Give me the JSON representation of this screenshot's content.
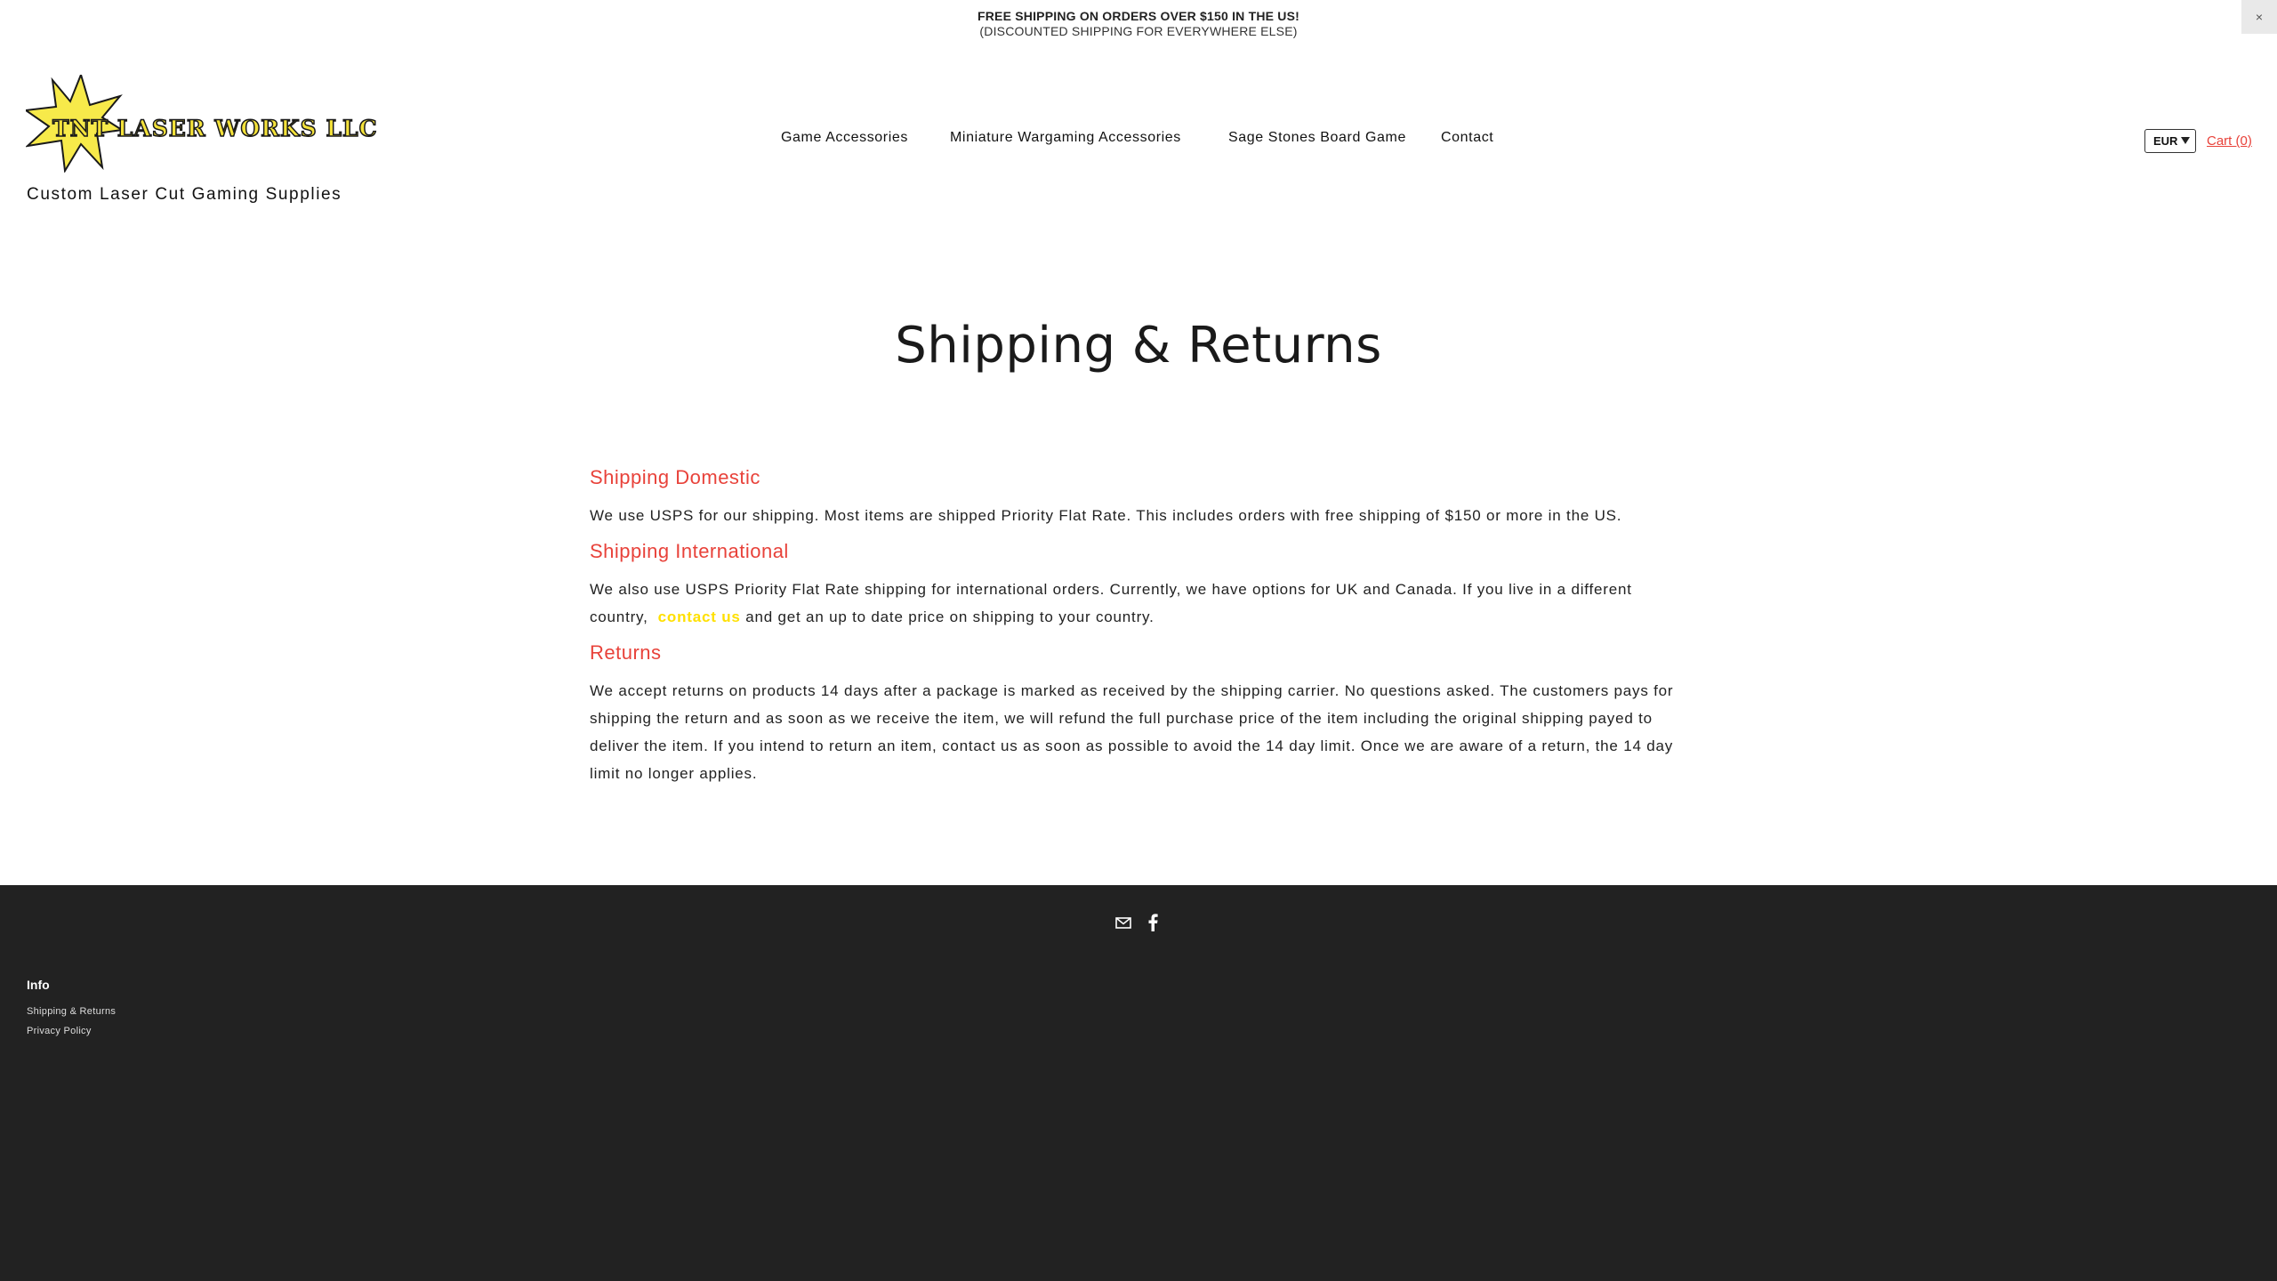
{
  "announcement": {
    "line1": "FREE SHIPPING ON ORDERS OVER $150 IN THE US!",
    "line2": "(DISCOUNTED SHIPPING FOR EVERYWHERE ELSE)",
    "close_label": "×"
  },
  "header": {
    "logo_text": "TNT LASER WORKS LLC",
    "tagline": "Custom Laser Cut Gaming Supplies",
    "nav": [
      {
        "label": "Game Accessories"
      },
      {
        "label": "Miniature Wargaming Accessories"
      },
      {
        "label": "Sage Stones Board Game"
      },
      {
        "label": "Contact"
      }
    ],
    "currency": "EUR",
    "cart_label": "Cart (0)"
  },
  "main": {
    "title": "Shipping & Returns",
    "sections": [
      {
        "heading": "Shipping Domestic",
        "text": "We use USPS for our shipping. Most items are shipped Priority Flat Rate. This includes orders with free shipping of $150 or more in the US."
      },
      {
        "heading": "Shipping International",
        "text_before": "We also use USPS Priority Flat Rate shipping for international orders. Currently, we have options for UK and Canada. If you live in a different country,",
        "link": "contact us",
        "text_after": "and get an up to date price on shipping to your country."
      },
      {
        "heading": "Returns",
        "text": "We accept returns on products 14 days after a package is marked as received by the shipping carrier. No questions asked. The customers pays for shipping the return and as soon as we receive the item, we will refund the full purchase price of the item including the original shipping payed to deliver the item. If you intend to return an item, contact us as soon as possible to avoid the 14 day limit. Once we are aware of a return, the 14 day limit no longer applies."
      }
    ]
  },
  "footer": {
    "social_icons": [
      "email-icon",
      "facebook-icon"
    ],
    "info_heading": "Info",
    "links": [
      {
        "label": "Shipping & Returns"
      },
      {
        "label": "Privacy Policy"
      }
    ]
  },
  "colors": {
    "accent": "#e8423a",
    "link_highlight": "#ffe000",
    "footer_bg": "#222222",
    "logo_star": "#f7ea4a"
  }
}
